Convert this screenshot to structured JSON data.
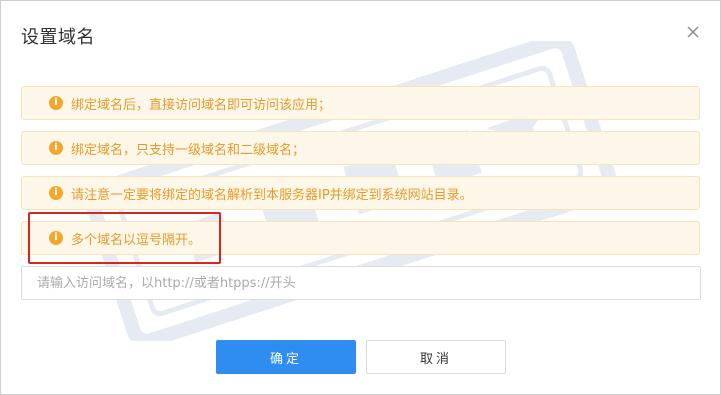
{
  "dialog": {
    "title": "设置域名",
    "notices": [
      "绑定域名后，直接访问域名即可访问该应用；",
      "绑定域名，只支持一级域名和二级域名；",
      "请注意一定要将绑定的域名解析到本服务器IP并绑定到系统网站目录。",
      "多个域名以逗号隔开。"
    ],
    "domain_input": {
      "value": "",
      "placeholder": "请输入访问域名，以http://或者htpps://开头"
    },
    "confirm_label": "确定",
    "cancel_label": "取消"
  },
  "icons": {
    "info": "info-icon",
    "close": "close-icon"
  },
  "colors": {
    "notice_bg": "#fdf7ea",
    "notice_text": "#e69b28",
    "primary": "#2f8df2",
    "highlight": "#d9251f"
  }
}
